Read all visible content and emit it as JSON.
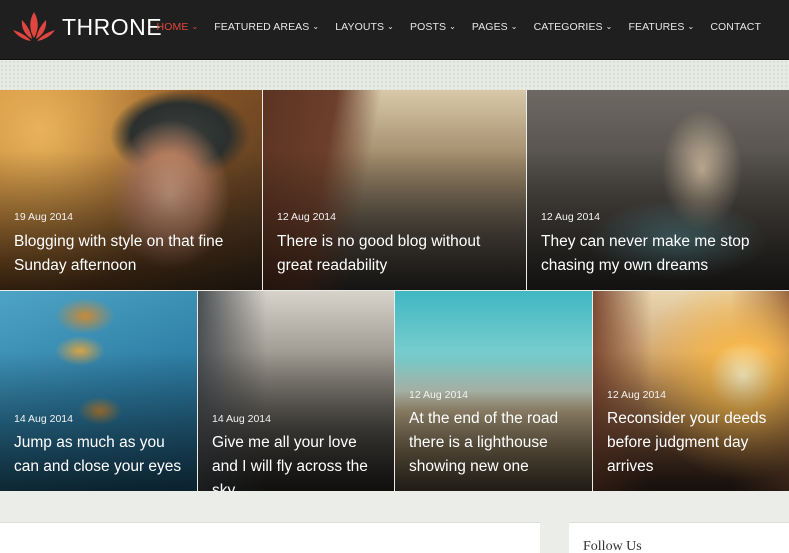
{
  "brand": {
    "name": "THRONE",
    "accent": "#e0463f"
  },
  "nav": {
    "items": [
      {
        "label": "HOME",
        "has_dropdown": true,
        "active": true
      },
      {
        "label": "FEATURED AREAS",
        "has_dropdown": true,
        "active": false
      },
      {
        "label": "LAYOUTS",
        "has_dropdown": true,
        "active": false
      },
      {
        "label": "POSTS",
        "has_dropdown": true,
        "active": false
      },
      {
        "label": "PAGES",
        "has_dropdown": true,
        "active": false
      },
      {
        "label": "CATEGORIES",
        "has_dropdown": true,
        "active": false
      },
      {
        "label": "FEATURES",
        "has_dropdown": true,
        "active": false
      },
      {
        "label": "CONTACT",
        "has_dropdown": false,
        "active": false
      }
    ]
  },
  "posts": [
    {
      "date": "19 Aug 2014",
      "title": "Blogging with style on that fine Sunday afternoon"
    },
    {
      "date": "12 Aug 2014",
      "title": "There is no good blog without great readability"
    },
    {
      "date": "12 Aug 2014",
      "title": "They can never make me stop chasing my own dreams"
    },
    {
      "date": "14 Aug 2014",
      "title": "Jump as much as you can and close your eyes"
    },
    {
      "date": "14 Aug 2014",
      "title": "Give me all your love and I will fly across the sky"
    },
    {
      "date": "12 Aug 2014",
      "title": "At the end of the road there is a lighthouse showing new one"
    },
    {
      "date": "12 Aug 2014",
      "title": "Reconsider your deeds before judgment day arrives"
    }
  ],
  "sidebar": {
    "follow_title": "Follow Us"
  },
  "icons": {
    "chevron": "chevron-down-icon",
    "logo": "lotus-logo-icon"
  }
}
